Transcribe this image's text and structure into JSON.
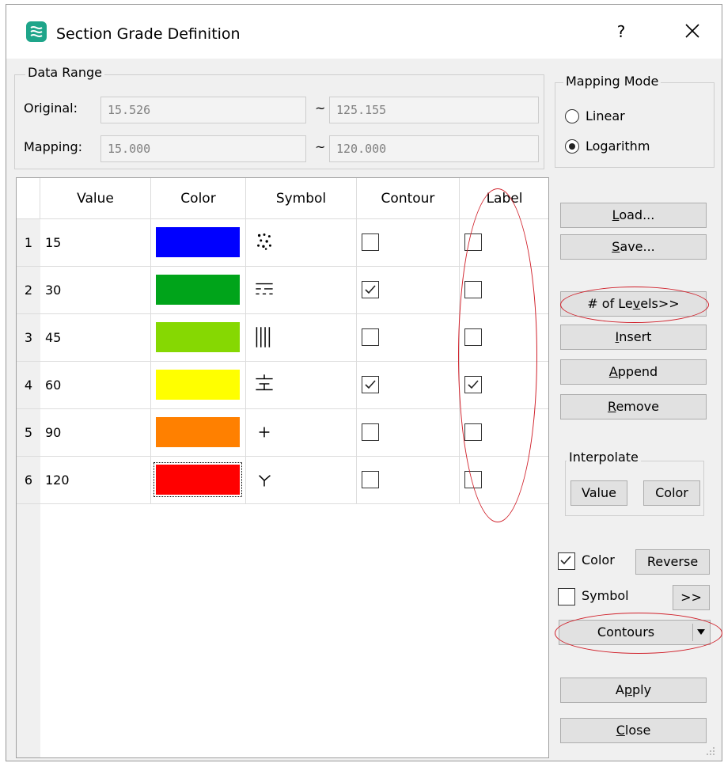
{
  "window": {
    "title": "Section Grade Definition",
    "help_label": "?",
    "close_label": "close"
  },
  "data_range": {
    "title": "Data Range",
    "original_label": "Original:",
    "original_min": "15.526",
    "original_max": "125.155",
    "mapping_label": "Mapping:",
    "mapping_min": "15.000",
    "mapping_max": "120.000",
    "tilde": "~"
  },
  "mapping_mode": {
    "title": "Mapping Mode",
    "linear_label": "Linear",
    "logarithm_label": "Logarithm",
    "selected": "Logarithm"
  },
  "table": {
    "headers": [
      "Value",
      "Color",
      "Symbol",
      "Contour",
      "Label"
    ],
    "rows": [
      {
        "num": "1",
        "value": "15",
        "color": "#0000ff",
        "symbol": "dots-icon",
        "contour": false,
        "label": false
      },
      {
        "num": "2",
        "value": "30",
        "color": "#00a41a",
        "symbol": "dashes-icon",
        "contour": true,
        "label": false
      },
      {
        "num": "3",
        "value": "45",
        "color": "#86d802",
        "symbol": "vertical-lines-icon",
        "contour": false,
        "label": false
      },
      {
        "num": "4",
        "value": "60",
        "color": "#ffff00",
        "symbol": "cross-bars-icon",
        "contour": true,
        "label": true
      },
      {
        "num": "5",
        "value": "90",
        "color": "#ff8000",
        "symbol": "plus-icon",
        "contour": false,
        "label": false
      },
      {
        "num": "6",
        "value": "120",
        "color": "#ff0000",
        "symbol": "fork-icon",
        "contour": false,
        "label": false
      }
    ]
  },
  "buttons": {
    "load": {
      "pre": "",
      "key": "L",
      "post": "oad..."
    },
    "save": {
      "pre": "",
      "key": "S",
      "post": "ave..."
    },
    "levels": {
      "pre": "# of Le",
      "key": "v",
      "post": "els>>"
    },
    "insert": {
      "pre": "",
      "key": "I",
      "post": "nsert"
    },
    "append": {
      "pre": "",
      "key": "A",
      "post": "ppend"
    },
    "remove": {
      "pre": "",
      "key": "R",
      "post": "emove"
    },
    "apply": {
      "pre": "A",
      "key": "p",
      "post": "ply"
    },
    "close": {
      "pre": "",
      "key": "C",
      "post": "lose"
    }
  },
  "interpolate": {
    "title": "Interpolate",
    "value_label": "Value",
    "color_label": "Color"
  },
  "options": {
    "color_label": "Color",
    "color_checked": true,
    "reverse_label": "Reverse",
    "symbol_label": "Symbol",
    "symbol_checked": false,
    "more_label": ">>",
    "contours_label": "Contours"
  }
}
